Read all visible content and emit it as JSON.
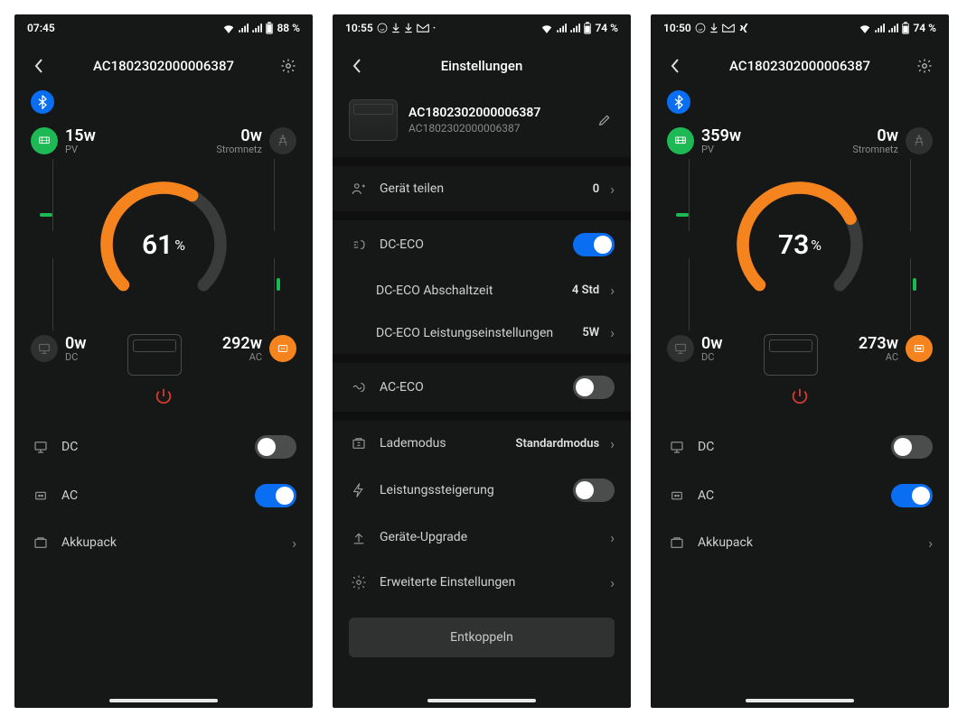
{
  "screens": [
    {
      "statusbar": {
        "time": "07:45",
        "battery": "88 %",
        "extra_icons": []
      },
      "header": {
        "title": "AC1802302000006387",
        "has_gear": true
      },
      "dashboard": {
        "pv": {
          "watt": "15w",
          "label": "PV"
        },
        "grid": {
          "watt": "0w",
          "label": "Stromnetz"
        },
        "dc": {
          "watt": "0w",
          "label": "DC"
        },
        "ac": {
          "watt": "292w",
          "label": "AC"
        },
        "soc": 61
      },
      "toggles": {
        "dc": {
          "label": "DC",
          "on": false
        },
        "ac": {
          "label": "AC",
          "on": true
        }
      },
      "battery_pack": {
        "label": "Akkupack"
      }
    },
    {
      "statusbar": {
        "time": "10:55",
        "battery": "74 %",
        "extra_icons": [
          "whatsapp",
          "down1",
          "down2",
          "mail",
          "dots"
        ]
      },
      "header": {
        "title": "Einstellungen",
        "has_gear": false
      },
      "device": {
        "name": "AC1802302000006387",
        "sub": "AC1802302000006387"
      },
      "rows": {
        "share": {
          "label": "Gerät teilen",
          "value": "0"
        },
        "dc_eco": {
          "label": "DC-ECO",
          "on": true
        },
        "dc_eco_time": {
          "label": "DC-ECO Abschaltzeit",
          "value": "4 Std"
        },
        "dc_eco_pwr": {
          "label": "DC-ECO Leistungseinstellungen",
          "value": "5W"
        },
        "ac_eco": {
          "label": "AC-ECO",
          "on": false
        },
        "charge": {
          "label": "Lademodus",
          "value": "Standardmodus"
        },
        "boost": {
          "label": "Leistungssteigerung",
          "on": false
        },
        "upgrade": {
          "label": "Geräte-Upgrade"
        },
        "advanced": {
          "label": "Erweiterte Einstellungen"
        }
      },
      "unpair": "Entkoppeln"
    },
    {
      "statusbar": {
        "time": "10:50",
        "battery": "74 %",
        "extra_icons": [
          "whatsapp",
          "down1",
          "mail",
          "xing"
        ]
      },
      "header": {
        "title": "AC1802302000006387",
        "has_gear": true
      },
      "dashboard": {
        "pv": {
          "watt": "359w",
          "label": "PV"
        },
        "grid": {
          "watt": "0w",
          "label": "Stromnetz"
        },
        "dc": {
          "watt": "0w",
          "label": "DC"
        },
        "ac": {
          "watt": "273w",
          "label": "AC"
        },
        "soc": 73
      },
      "toggles": {
        "dc": {
          "label": "DC",
          "on": false
        },
        "ac": {
          "label": "AC",
          "on": true
        }
      },
      "battery_pack": {
        "label": "Akkupack"
      }
    }
  ]
}
